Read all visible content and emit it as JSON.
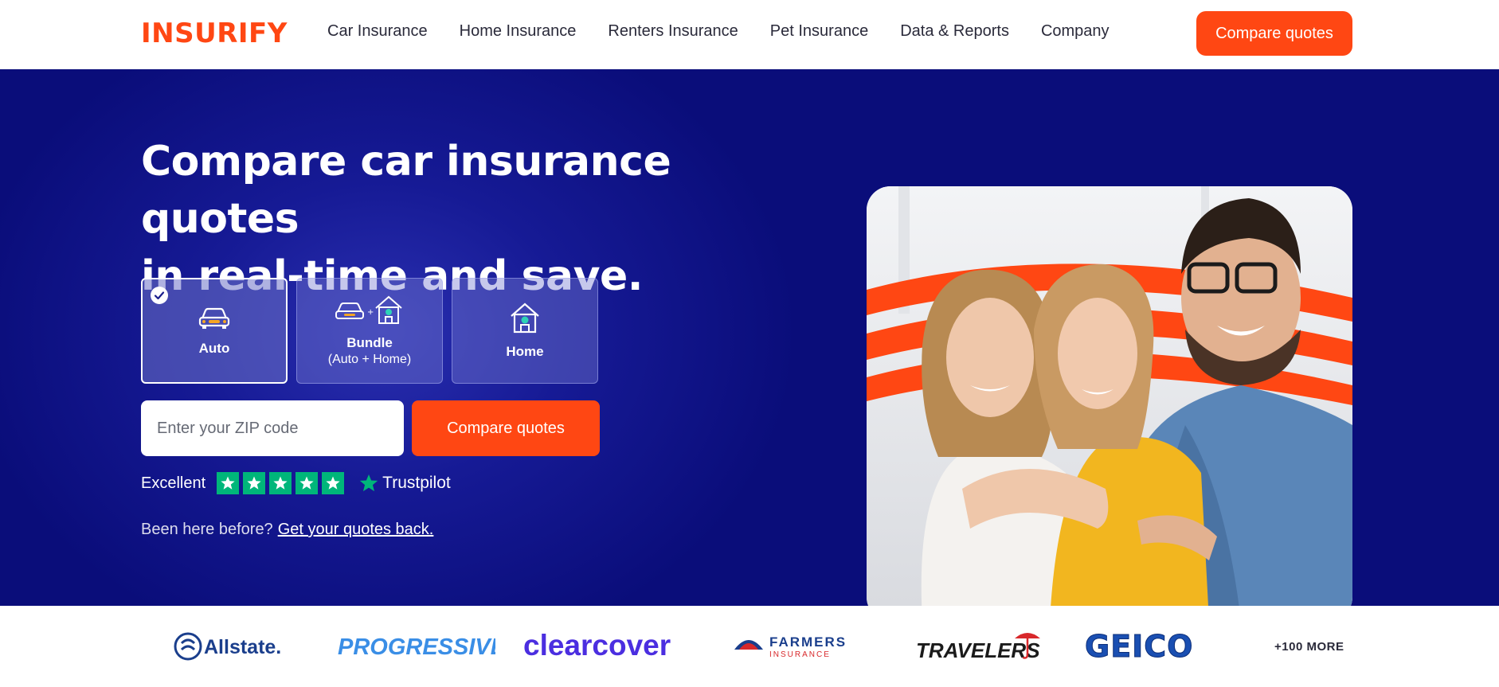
{
  "header": {
    "logo": "INSURIFY",
    "nav": [
      "Car Insurance",
      "Home Insurance",
      "Renters Insurance",
      "Pet Insurance",
      "Data & Reports",
      "Company"
    ],
    "cta_label": "Compare quotes"
  },
  "hero": {
    "title_line1": "Compare car insurance quotes",
    "title_line2": "in real-time and save.",
    "cards": [
      {
        "label": "Auto",
        "sub": "",
        "selected": true
      },
      {
        "label": "Bundle",
        "sub": "(Auto + Home)",
        "selected": false
      },
      {
        "label": "Home",
        "sub": "",
        "selected": false
      }
    ],
    "zip_placeholder": "Enter your ZIP code",
    "cta_label": "Compare quotes",
    "rating_text": "Excellent",
    "rating_stars": 5,
    "trustpilot": "Trustpilot",
    "returning_text": "Been here before?",
    "returning_link": "Get your quotes back."
  },
  "carriers": {
    "logos": [
      "Allstate.",
      "PROGRESSIVE",
      "clearcover",
      "FARMERS",
      "INSURANCE",
      "TRAVELERS",
      "GEICO"
    ],
    "more_label": "+100 MORE"
  },
  "colors": {
    "brand": "#ff4713",
    "hero_bg": "#0a0d7a",
    "trustpilot_green": "#00b67a"
  }
}
